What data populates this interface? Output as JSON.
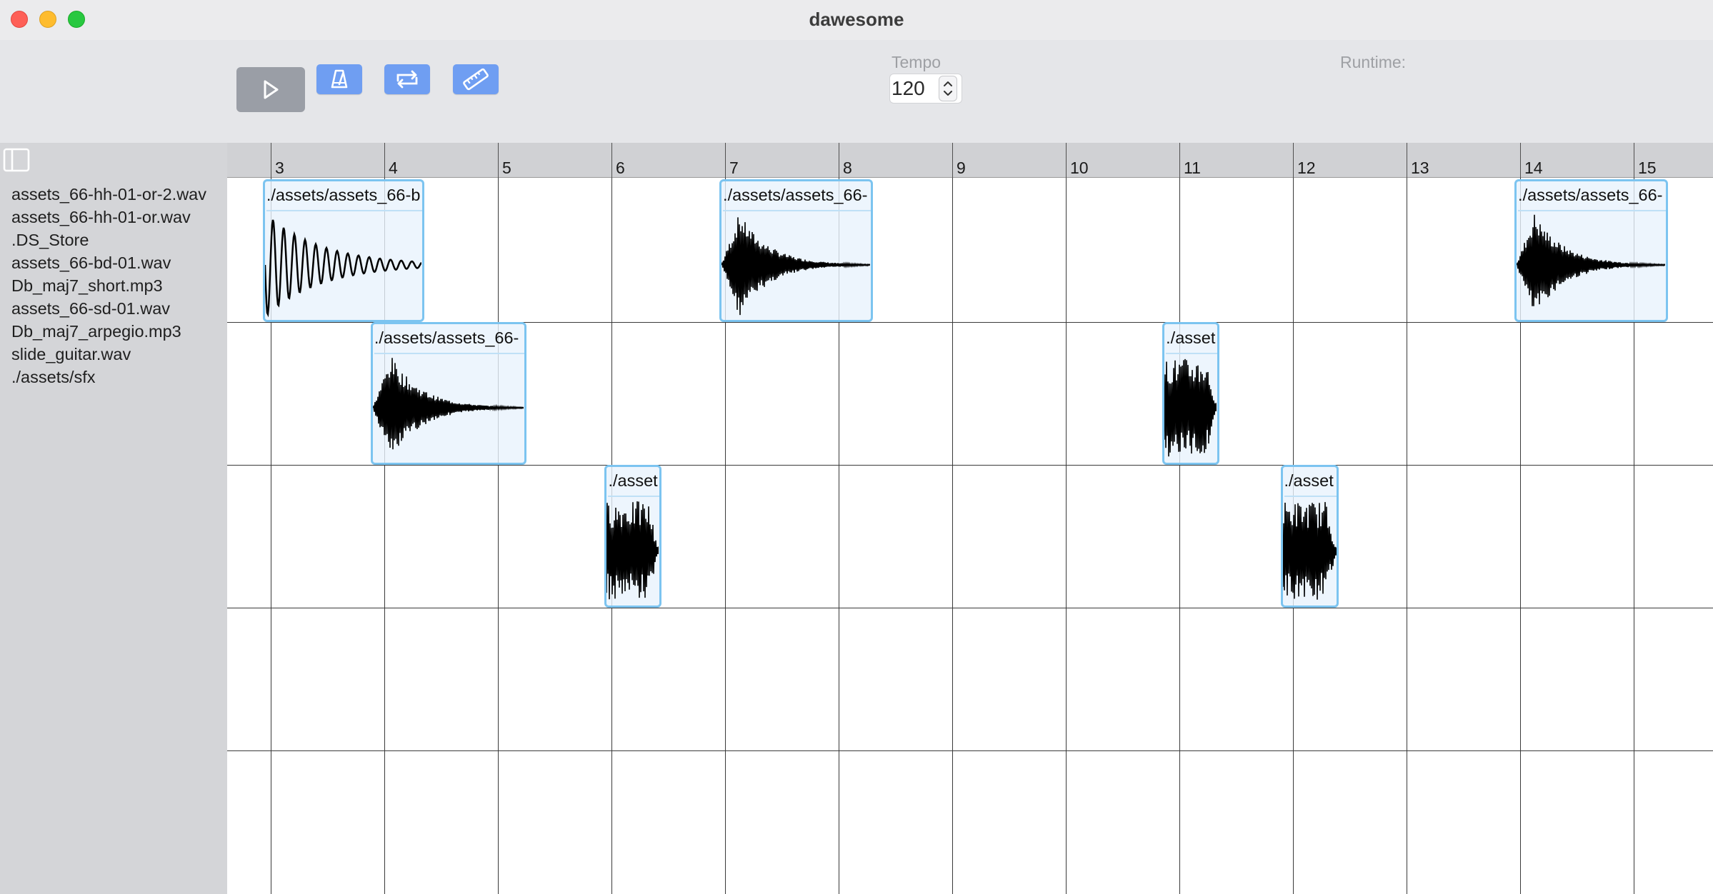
{
  "window": {
    "title": "dawesome"
  },
  "toolbar": {
    "play_icon": "play-icon",
    "metronome_icon": "metronome-icon",
    "loop_icon": "loop-icon",
    "ruler_icon": "ruler-icon",
    "tempo_label": "Tempo",
    "tempo_value": "120",
    "runtime_label": "Runtime:"
  },
  "sidebar": {
    "toggle_icon": "sidebar-toggle-icon",
    "files": [
      "assets_66-hh-01-or-2.wav",
      "assets_66-hh-01-or.wav",
      ".DS_Store",
      "assets_66-bd-01.wav",
      "Db_maj7_short.mp3",
      "assets_66-sd-01.wav",
      "Db_maj7_arpegio.mp3",
      "slide_guitar.wav",
      "./assets/sfx"
    ]
  },
  "timeline": {
    "bar_numbers": [
      "3",
      "4",
      "5",
      "6",
      "7",
      "8",
      "9",
      "10",
      "11",
      "12",
      "13",
      "14",
      "15"
    ],
    "clips": [
      {
        "label": "./assets/assets_66-b",
        "track": 1,
        "start_bar": 2.93,
        "end_bar": 4.35,
        "wave": "low"
      },
      {
        "label": "./assets/assets_66-",
        "track": 1,
        "start_bar": 6.95,
        "end_bar": 8.3,
        "wave": "burst"
      },
      {
        "label": "./assets/assets_66-",
        "track": 1,
        "start_bar": 13.95,
        "end_bar": 15.3,
        "wave": "burst"
      },
      {
        "label": "./assets/assets_66-",
        "track": 2,
        "start_bar": 3.88,
        "end_bar": 5.25,
        "wave": "burst"
      },
      {
        "label": "./asset",
        "track": 2,
        "start_bar": 10.85,
        "end_bar": 11.35,
        "wave": "noise"
      },
      {
        "label": "./asset",
        "track": 3,
        "start_bar": 5.94,
        "end_bar": 6.44,
        "wave": "noise"
      },
      {
        "label": "./asset",
        "track": 3,
        "start_bar": 11.89,
        "end_bar": 12.4,
        "wave": "noise"
      }
    ]
  }
}
